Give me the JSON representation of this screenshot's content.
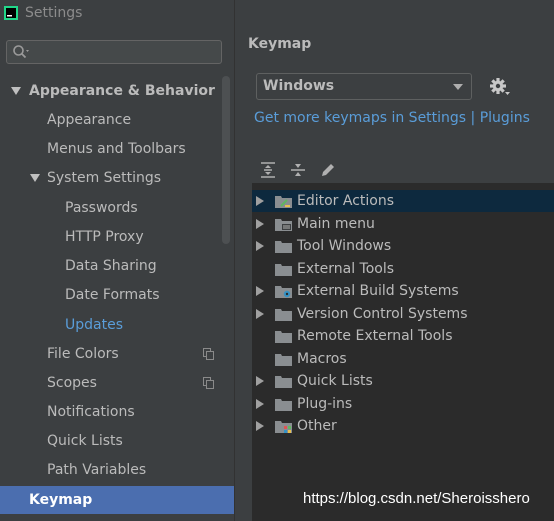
{
  "window": {
    "title": "Settings"
  },
  "search": {
    "placeholder": ""
  },
  "sidebar": {
    "items": [
      {
        "label": "Appearance & Behavior"
      },
      {
        "label": "Appearance"
      },
      {
        "label": "Menus and Toolbars"
      },
      {
        "label": "System Settings"
      },
      {
        "label": "Passwords"
      },
      {
        "label": "HTTP Proxy"
      },
      {
        "label": "Data Sharing"
      },
      {
        "label": "Date Formats"
      },
      {
        "label": "Updates"
      },
      {
        "label": "File Colors"
      },
      {
        "label": "Scopes"
      },
      {
        "label": "Notifications"
      },
      {
        "label": "Quick Lists"
      },
      {
        "label": "Path Variables"
      },
      {
        "label": "Keymap"
      }
    ]
  },
  "main": {
    "title": "Keymap",
    "keymap_selected": "Windows",
    "get_more_link": "Get more keymaps in Settings | Plugins",
    "actions": [
      {
        "label": "Editor Actions",
        "expandable": true,
        "icon": "editor-actions-folder-icon"
      },
      {
        "label": "Main menu",
        "expandable": true,
        "icon": "main-menu-folder-icon"
      },
      {
        "label": "Tool Windows",
        "expandable": true,
        "icon": "folder-icon"
      },
      {
        "label": "External Tools",
        "expandable": false,
        "icon": "folder-icon"
      },
      {
        "label": "External Build Systems",
        "expandable": true,
        "icon": "build-systems-folder-icon"
      },
      {
        "label": "Version Control Systems",
        "expandable": true,
        "icon": "folder-icon"
      },
      {
        "label": "Remote External Tools",
        "expandable": false,
        "icon": "folder-icon"
      },
      {
        "label": "Macros",
        "expandable": false,
        "icon": "folder-icon"
      },
      {
        "label": "Quick Lists",
        "expandable": true,
        "icon": "folder-icon"
      },
      {
        "label": "Plug-ins",
        "expandable": true,
        "icon": "folder-icon"
      },
      {
        "label": "Other",
        "expandable": true,
        "icon": "other-folder-icon"
      }
    ]
  },
  "watermark": "https://blog.csdn.net/Sheroisshero",
  "colors": {
    "accent": "#4b6eaf",
    "link": "#5a9dd9",
    "background": "#3c3f41",
    "list_background": "#2b2b2b"
  }
}
